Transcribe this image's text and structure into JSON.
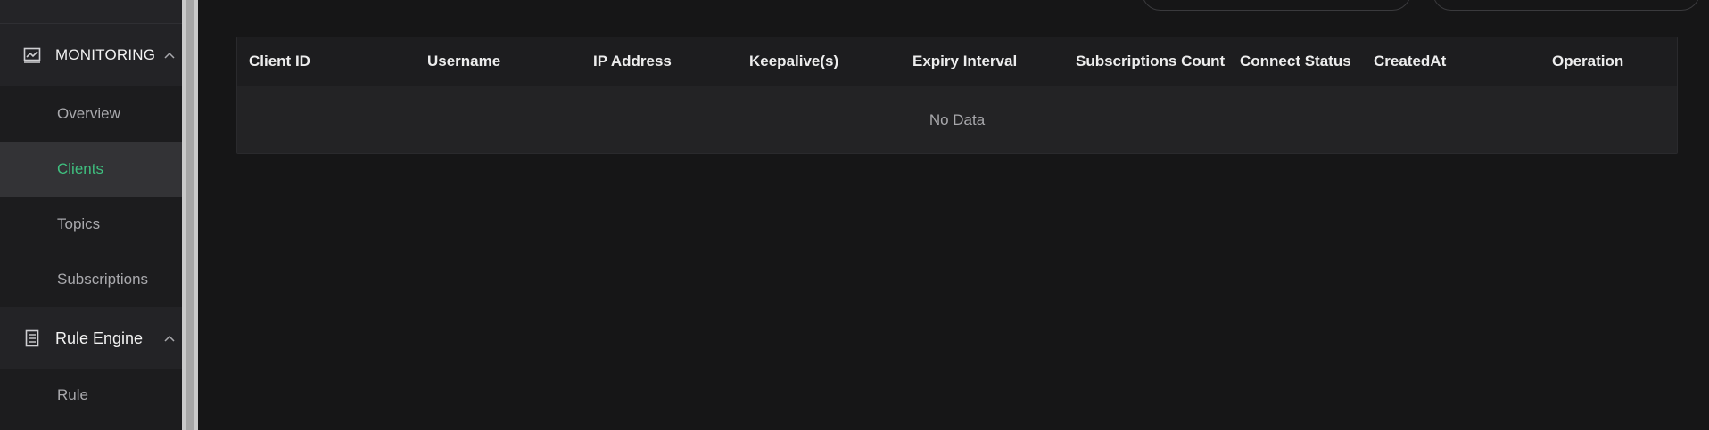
{
  "sidebar": {
    "groups": [
      {
        "label": "MONITORING",
        "icon": "monitor-chart-icon"
      },
      {
        "label": "Rule Engine",
        "icon": "document-list-icon"
      }
    ],
    "monitoring_items": [
      {
        "label": "Overview"
      },
      {
        "label": "Clients",
        "active": true
      },
      {
        "label": "Topics"
      },
      {
        "label": "Subscriptions"
      }
    ],
    "rule_engine_items": [
      {
        "label": "Rule"
      }
    ]
  },
  "table": {
    "columns": [
      "Client ID",
      "Username",
      "IP Address",
      "Keepalive(s)",
      "Expiry Interval",
      "Subscriptions Count",
      "Connect Status",
      "CreatedAt",
      "Operation"
    ],
    "empty_text": "No Data"
  },
  "colors": {
    "accent": "#3fbf7f",
    "background": "#161617",
    "sidebar": "#1c1c1e"
  }
}
